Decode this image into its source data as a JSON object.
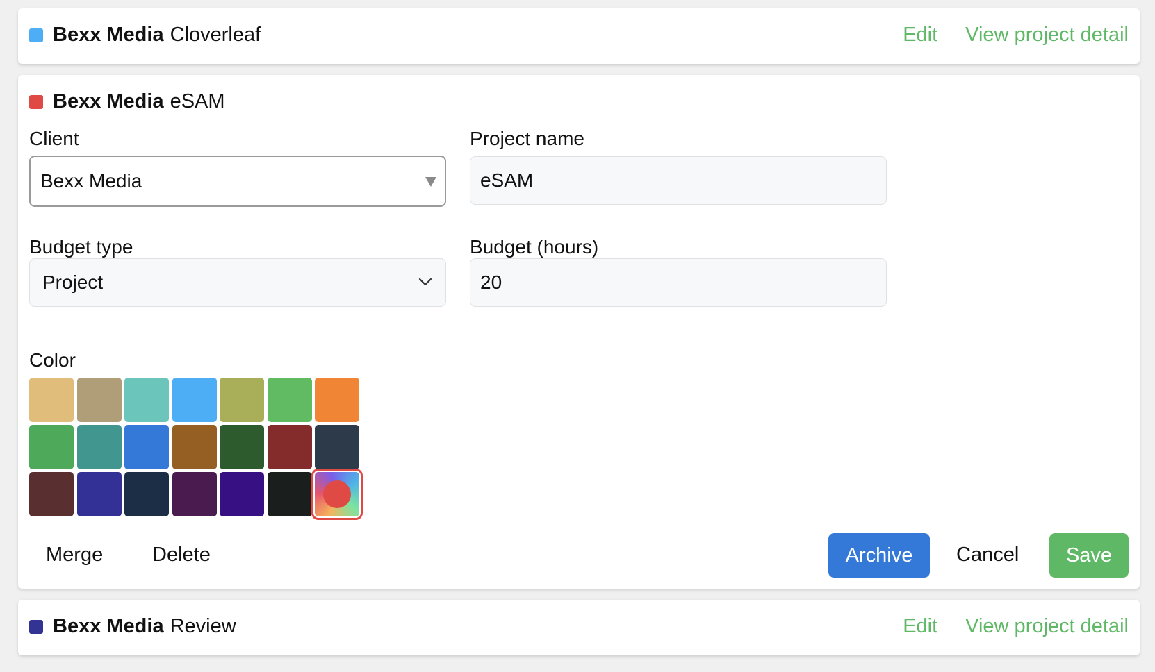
{
  "projects": [
    {
      "client": "Bexx Media",
      "name": "Cloverleaf",
      "color": "#4dadf5",
      "edit_label": "Edit",
      "detail_label": "View project detail"
    },
    {
      "client": "Bexx Media",
      "name": "eSAM",
      "color": "#e04a44"
    },
    {
      "client": "Bexx Media",
      "name": "Review",
      "color": "#323393",
      "edit_label": "Edit",
      "detail_label": "View project detail"
    }
  ],
  "form": {
    "client_label": "Client",
    "client_value": "Bexx Media",
    "project_name_label": "Project name",
    "project_name_value": "eSAM",
    "budget_type_label": "Budget type",
    "budget_type_value": "Project",
    "budget_hours_label": "Budget (hours)",
    "budget_hours_value": "20",
    "color_label": "Color",
    "palette": [
      [
        "#e0bd7b",
        "#b09e79",
        "#6cc5bb",
        "#4dadf5",
        "#a8af58",
        "#61bb63",
        "#f08535"
      ],
      [
        "#4ea95b",
        "#419790",
        "#3579d8",
        "#955e22",
        "#2d5b2d",
        "#842b2b",
        "#2d3a4a"
      ],
      [
        "#5a2f2f",
        "#343196",
        "#1c2e45",
        "#4a1b4f",
        "#371084",
        "#1a1e1d",
        "custom"
      ]
    ],
    "selected_color": "#e04a44"
  },
  "actions": {
    "merge": "Merge",
    "delete": "Delete",
    "archive": "Archive",
    "cancel": "Cancel",
    "save": "Save",
    "archive_color": "#3579d8",
    "save_color": "#5fb865"
  }
}
